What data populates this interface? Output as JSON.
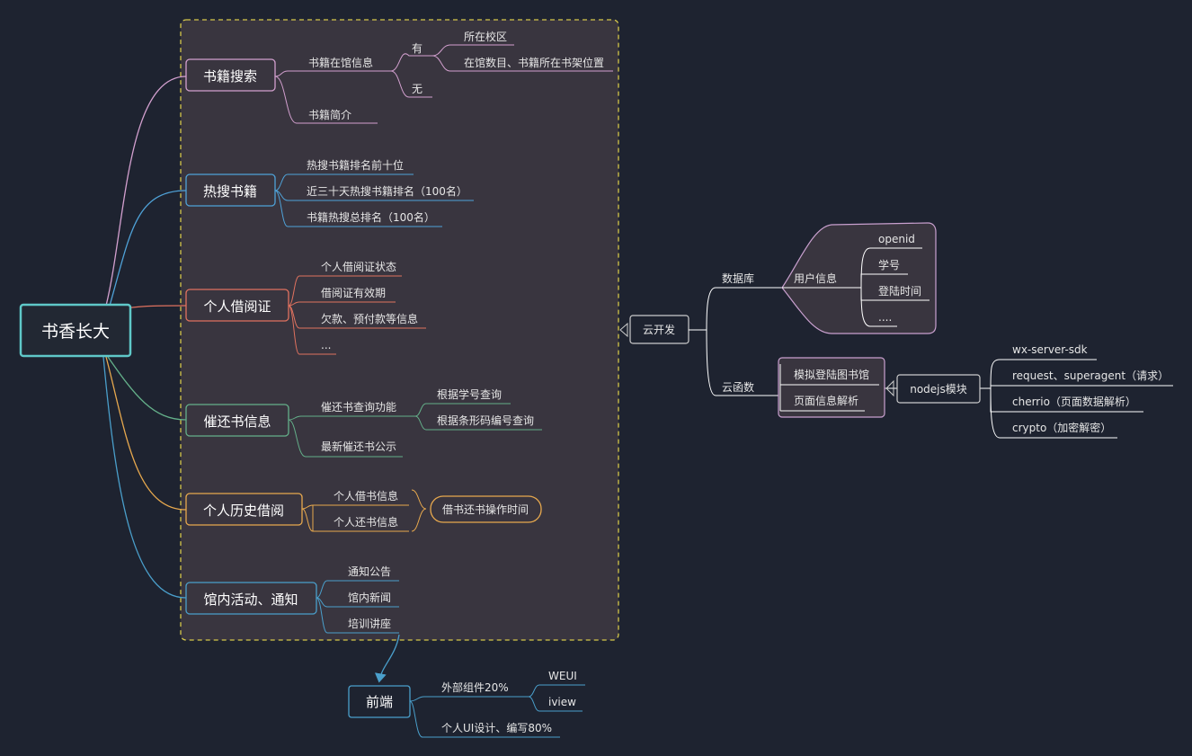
{
  "root": {
    "label": "书香长大"
  },
  "branches": {
    "search": {
      "label": "书籍搜索",
      "children": {
        "info": "书籍在馆信息",
        "yes": "有",
        "campus": "所在校区",
        "shelf": "在馆数目、书籍所在书架位置",
        "no": "无",
        "intro": "书籍简介"
      }
    },
    "hot": {
      "label": "热搜书籍",
      "children": [
        "热搜书籍排名前十位",
        "近三十天热搜书籍排名（100名）",
        "书籍热搜总排名（100名）"
      ]
    },
    "card": {
      "label": "个人借阅证",
      "children": [
        "个人借阅证状态",
        "借阅证有效期",
        "欠款、预付款等信息",
        "..."
      ]
    },
    "remind": {
      "label": "催还书信息",
      "children": {
        "query": "催还书查询功能",
        "by_id": "根据学号查询",
        "by_code": "根据条形码编号查询",
        "latest": "最新催还书公示"
      }
    },
    "history": {
      "label": "个人历史借阅",
      "children": [
        "个人借书信息",
        "个人还书信息"
      ],
      "summary": "借书还书操作时间"
    },
    "activity": {
      "label": "馆内活动、通知",
      "children": [
        "通知公告",
        "馆内新闻",
        "培训讲座"
      ]
    }
  },
  "cloud": {
    "label": "云开发",
    "database": {
      "label": "数据库",
      "user_info": "用户信息",
      "fields": [
        "openid",
        "学号",
        "登陆时间",
        "...."
      ]
    },
    "functions": {
      "label": "云函数",
      "items": [
        "模拟登陆图书馆",
        "页面信息解析"
      ],
      "module": "nodejs模块",
      "libs": [
        "wx-server-sdk",
        "request、superagent（请求）",
        "cherrio（页面数据解析）",
        "crypto（加密解密）"
      ]
    }
  },
  "frontend": {
    "label": "前端",
    "external": "外部组件20%",
    "components": [
      "WEUI",
      "iview"
    ],
    "custom": "个人UI设计、编写80%"
  },
  "colors": {
    "background": "#1e2330",
    "panel": "#39353f",
    "dashed_border": "#d6c84a",
    "root_border": "#5fc8c8",
    "search": "#d3a0cf",
    "hot": "#4fa2d8",
    "card": "#e0725f",
    "remind": "#64b08a",
    "history": "#e8a94e",
    "activity": "#4a9fcb",
    "cloud": "#c9a0cf",
    "line": "#ffffff"
  }
}
